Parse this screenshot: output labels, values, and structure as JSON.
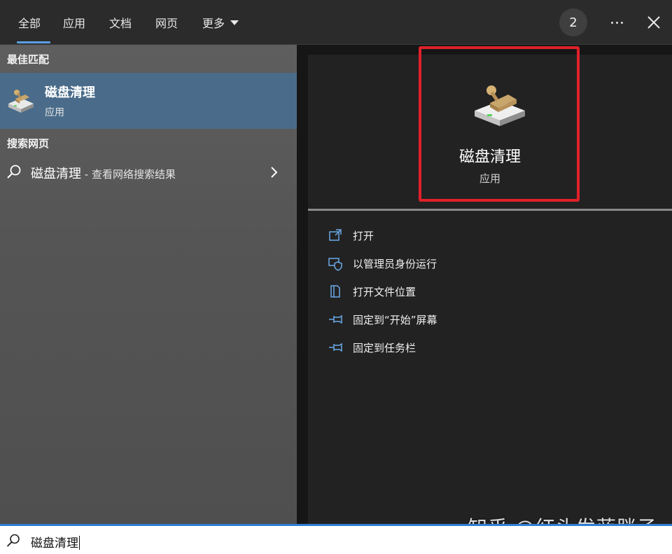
{
  "tabs": [
    {
      "label": "全部",
      "active": true
    },
    {
      "label": "应用"
    },
    {
      "label": "文档"
    },
    {
      "label": "网页"
    },
    {
      "label": "更多"
    }
  ],
  "badge_count": "2",
  "left": {
    "best_match_heading": "最佳匹配",
    "best_match": {
      "title": "磁盘清理",
      "subtitle": "应用",
      "icon": "disk-cleanup-icon"
    },
    "web_heading": "搜索网页",
    "web_item": {
      "title": "磁盘清理",
      "suffix": " - 查看网络搜索结果",
      "icon": "search-icon"
    }
  },
  "right": {
    "title": "磁盘清理",
    "subtitle": "应用",
    "actions": [
      {
        "label": "打开",
        "icon": "open-icon"
      },
      {
        "label": "以管理员身份运行",
        "icon": "shield-icon"
      },
      {
        "label": "打开文件位置",
        "icon": "file-location-icon"
      },
      {
        "label": "固定到“开始”屏幕",
        "icon": "pin-icon"
      },
      {
        "label": "固定到任务栏",
        "icon": "pin-icon"
      }
    ]
  },
  "search": {
    "value": "磁盘清理",
    "icon": "search-icon"
  },
  "watermark": "知乎 @红头发蓝胖子",
  "colors": {
    "accent": "#2d7dd2",
    "selection": "#4a6c8a",
    "highlight": "#e0212a"
  }
}
